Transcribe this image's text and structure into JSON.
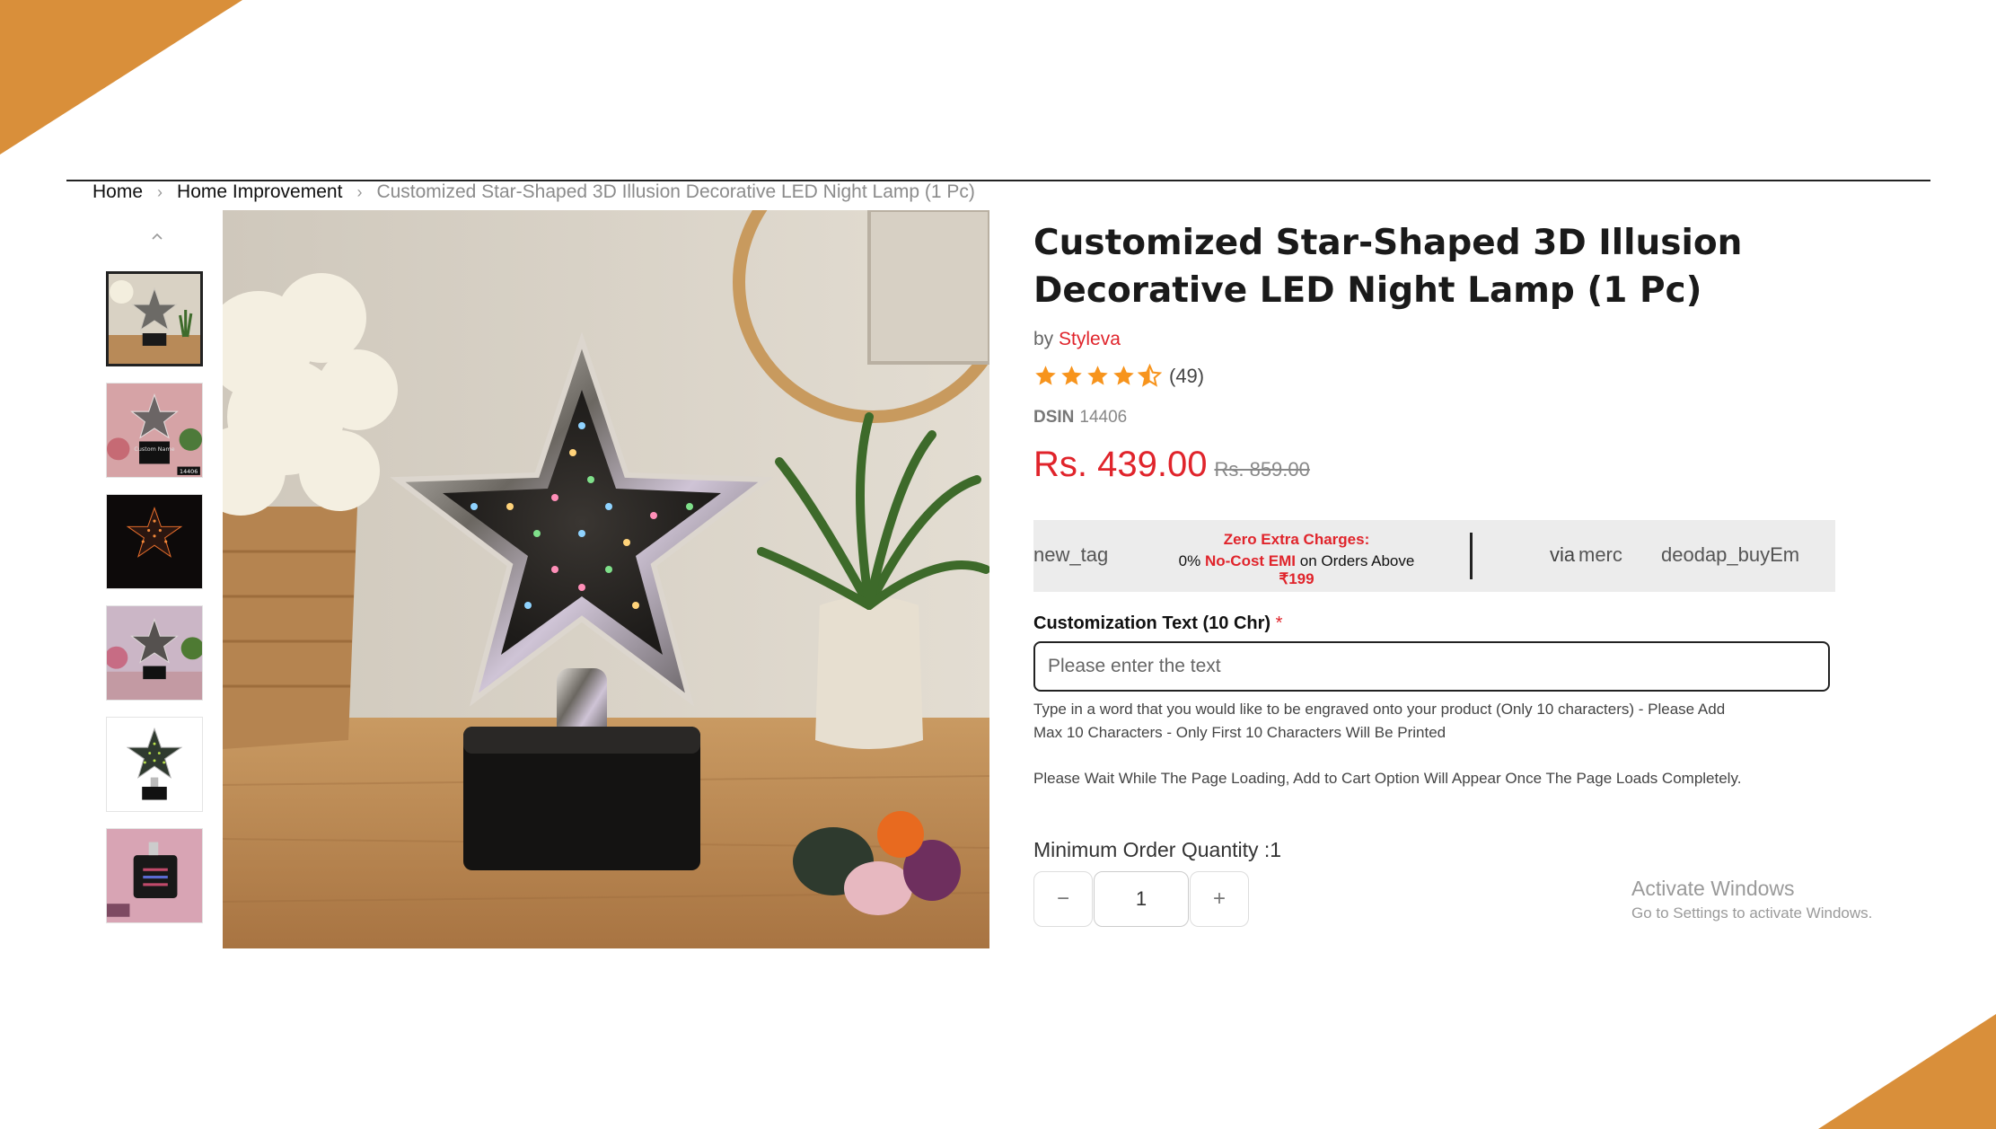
{
  "breadcrumb": {
    "home": "Home",
    "category": "Home Improvement",
    "current": "Customized Star-Shaped 3D Illusion Decorative LED Night Lamp (1 Pc)"
  },
  "gallery": {
    "thumbnails": [
      "thumb-1",
      "thumb-2",
      "thumb-3",
      "thumb-4",
      "thumb-5",
      "thumb-6"
    ],
    "active_index": 0,
    "thumb2_label": "Custom Name",
    "thumb2_code": "14406"
  },
  "product": {
    "title": "Customized Star-Shaped 3D Illusion Decorative LED Night Lamp (1 Pc)",
    "by_prefix": "by",
    "brand": "Styleva",
    "rating": 4.5,
    "rating_count": "(49)",
    "dsin_label": "DSIN",
    "dsin_value": "14406",
    "price": "Rs. 439.00",
    "compare_price": "Rs. 859.00"
  },
  "emi": {
    "tag_alt": "new_tag",
    "headline": "Zero Extra Charges:",
    "line_pre": "0%",
    "line_red": "No-Cost EMI",
    "line_mid": "on Orders Above",
    "line_amount": "₹199",
    "via": "via",
    "merchant_alt": "merc",
    "buy_alt": "deodap_buyEm"
  },
  "customization": {
    "label": "Customization Text (10 Chr)",
    "required_mark": "*",
    "placeholder": "Please enter the text",
    "help": "Type in a word that you would like to be engraved onto your product (Only 10 characters) - Please Add Max 10 Characters - Only First 10 Characters Will Be Printed",
    "loading_note": "Please Wait While The Page Loading, Add to Cart Option Will Appear Once The Page Loads Completely."
  },
  "quantity": {
    "min_label": "Minimum Order Quantity :1",
    "value": "1",
    "minus": "−",
    "plus": "+"
  },
  "watermark": {
    "title": "Activate Windows",
    "subtitle": "Go to Settings to activate Windows."
  },
  "colors": {
    "accent_red": "#e0242b",
    "star_orange": "#f7941d",
    "corner_orange": "#d98f3a"
  }
}
